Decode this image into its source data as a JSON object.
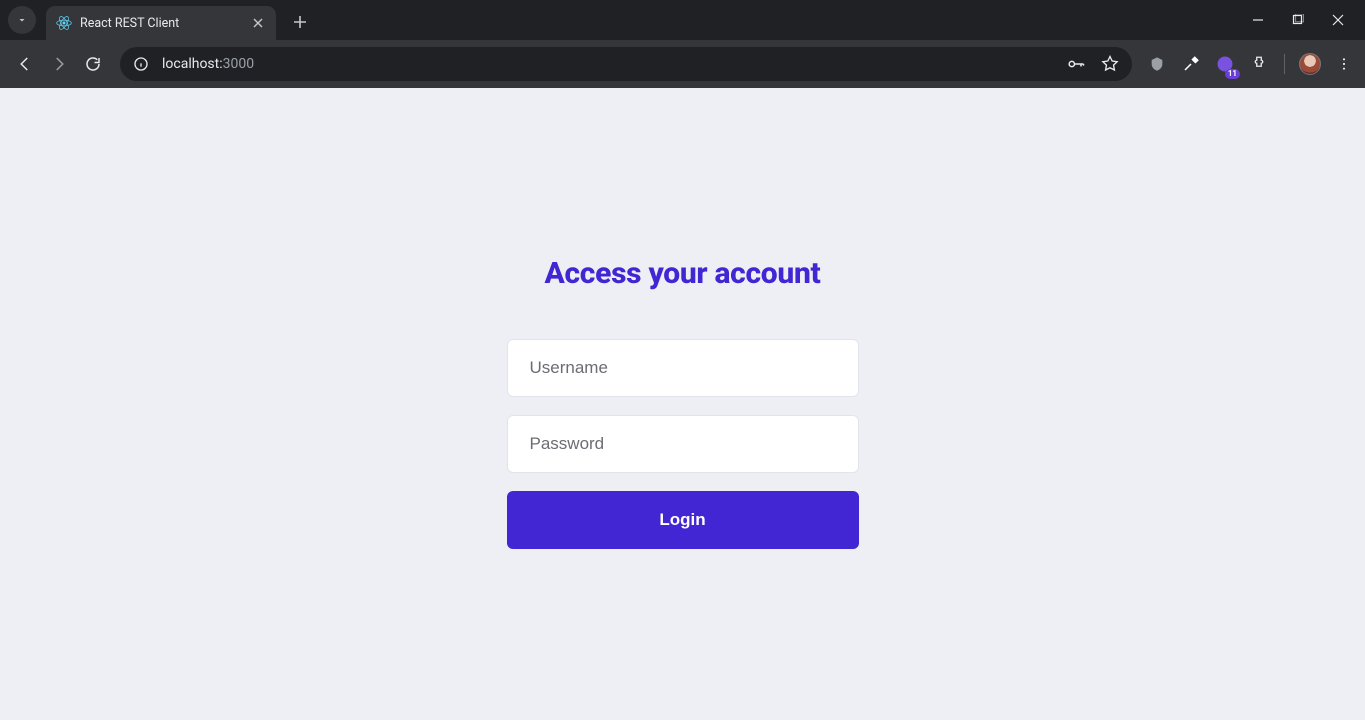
{
  "browser": {
    "tab_title": "React REST Client",
    "url_host": "localhost:",
    "url_port": "3000",
    "badge_count": "11"
  },
  "login": {
    "title": "Access your account",
    "username_placeholder": "Username",
    "password_placeholder": "Password",
    "button_label": "Login"
  }
}
